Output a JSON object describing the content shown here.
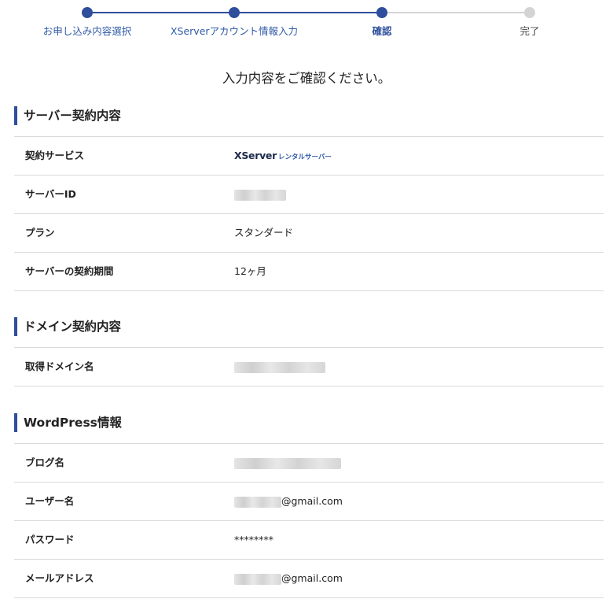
{
  "stepper": {
    "steps": [
      {
        "label": "お申し込み内容選択",
        "state": "done"
      },
      {
        "label": "XServerアカウント情報入力",
        "state": "done"
      },
      {
        "label": "確認",
        "state": "current"
      },
      {
        "label": "完了",
        "state": "todo"
      }
    ]
  },
  "lead_text": "入力内容をご確認ください。",
  "server_section": {
    "title": "サーバー契約内容",
    "rows": [
      {
        "label": "契約サービス",
        "logo_main": "XServer",
        "logo_sub": "レンタルサーバー"
      },
      {
        "label": "サーバーID"
      },
      {
        "label": "プラン",
        "value": "スタンダード"
      },
      {
        "label": "サーバーの契約期間",
        "value": "12ヶ月"
      }
    ]
  },
  "domain_section": {
    "title": "ドメイン契約内容",
    "rows": [
      {
        "label": "取得ドメイン名"
      }
    ]
  },
  "wordpress_section": {
    "title": "WordPress情報",
    "rows": [
      {
        "label": "ブログ名"
      },
      {
        "label": "ユーザー名",
        "value_suffix": "@gmail.com"
      },
      {
        "label": "パスワード",
        "value": "********"
      },
      {
        "label": "メールアドレス",
        "value_suffix": "@gmail.com"
      }
    ]
  },
  "colors": {
    "accent": "#2f4e9b",
    "inactive": "#d4d4d4",
    "border": "#d9d9d9"
  }
}
